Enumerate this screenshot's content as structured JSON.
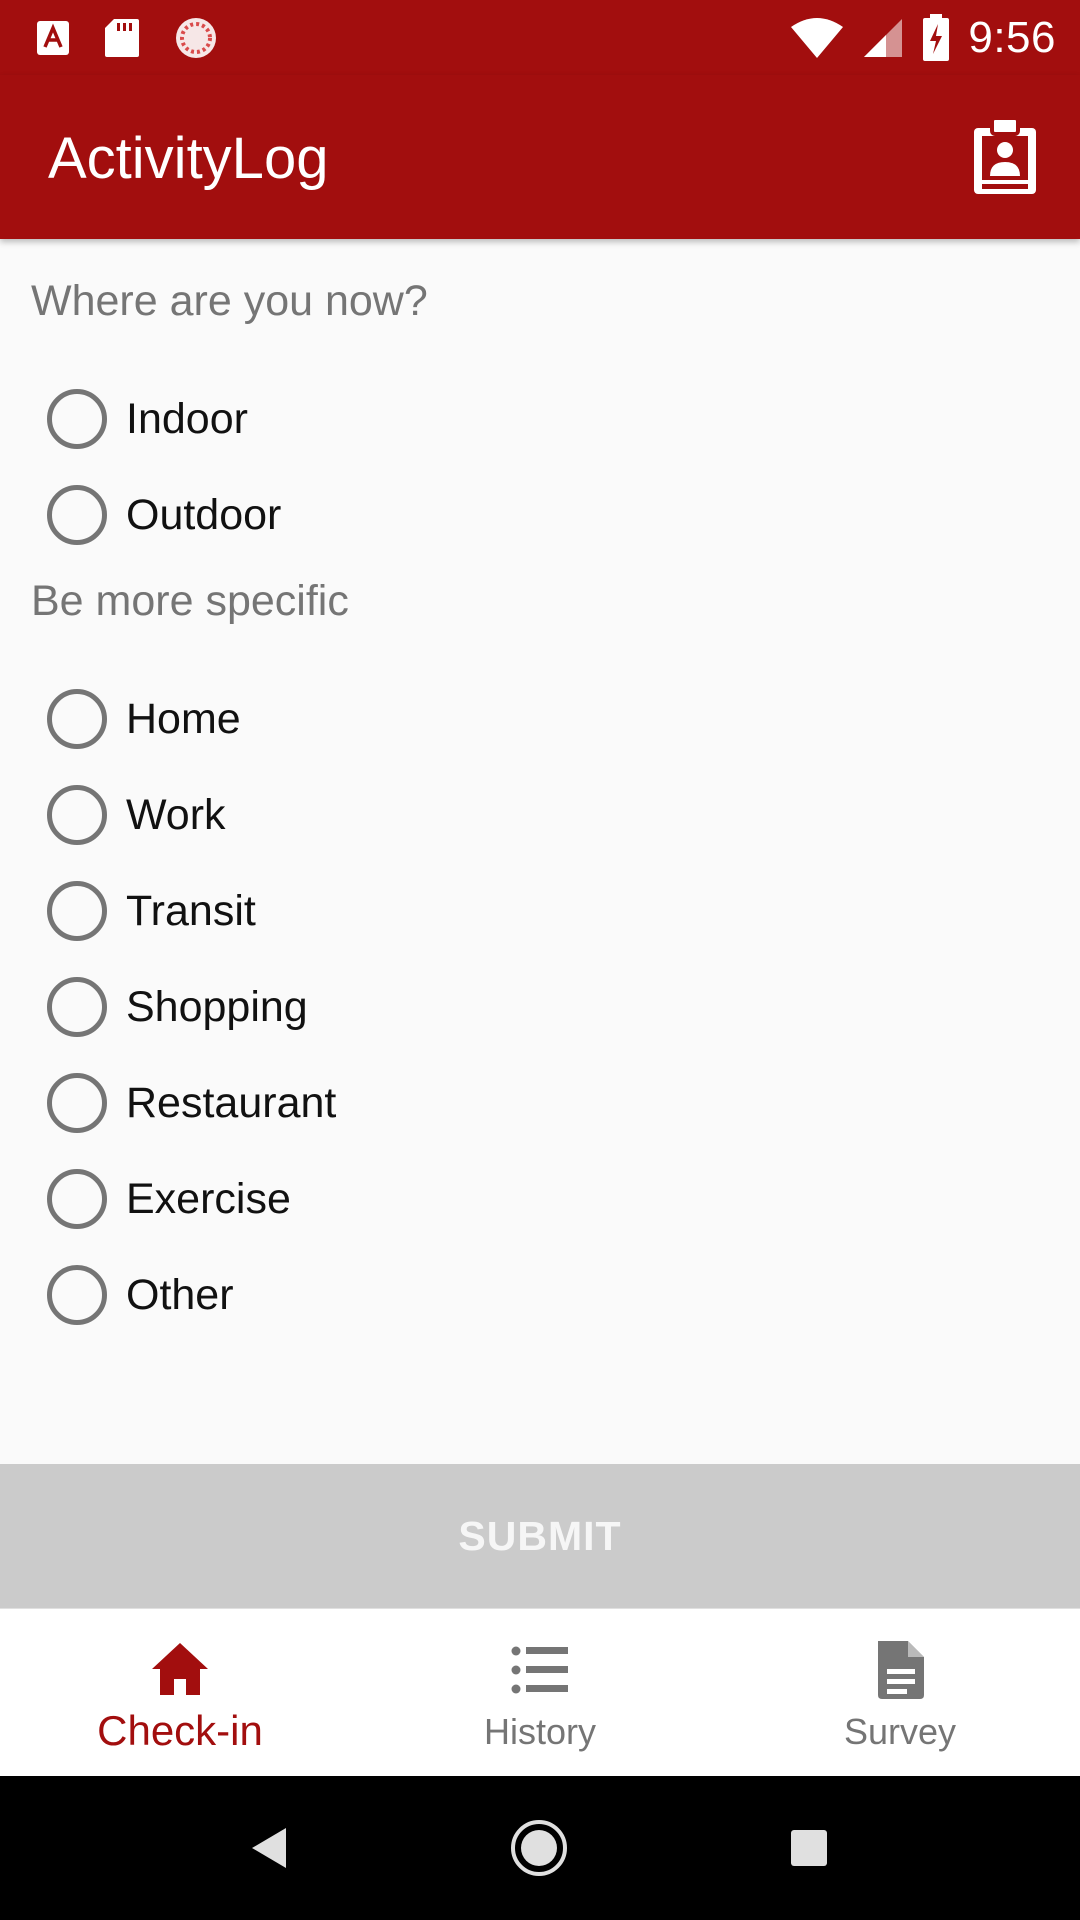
{
  "status_bar": {
    "time": "9:56",
    "icons": [
      "font-a-icon",
      "sd-card-icon",
      "sync-circle-icon",
      "wifi-icon",
      "cell-signal-icon",
      "battery-charging-icon"
    ]
  },
  "app_bar": {
    "title": "ActivityLog",
    "action_icon": "badge-icon"
  },
  "form": {
    "location_question": "Where are you now?",
    "location_options": [
      "Indoor",
      "Outdoor"
    ],
    "specific_question": "Be more specific",
    "specific_options": [
      "Home",
      "Work",
      "Transit",
      "Shopping",
      "Restaurant",
      "Exercise",
      "Other"
    ]
  },
  "submit": {
    "label": "SUBMIT"
  },
  "bottom_nav": {
    "items": [
      {
        "label": "Check-in",
        "icon": "home-icon",
        "active": true
      },
      {
        "label": "History",
        "icon": "list-icon",
        "active": false
      },
      {
        "label": "Survey",
        "icon": "document-icon",
        "active": false
      }
    ]
  },
  "colors": {
    "primary": "#a20e0e",
    "inactive": "#757575",
    "submit_disabled": "#cbcbcb"
  }
}
